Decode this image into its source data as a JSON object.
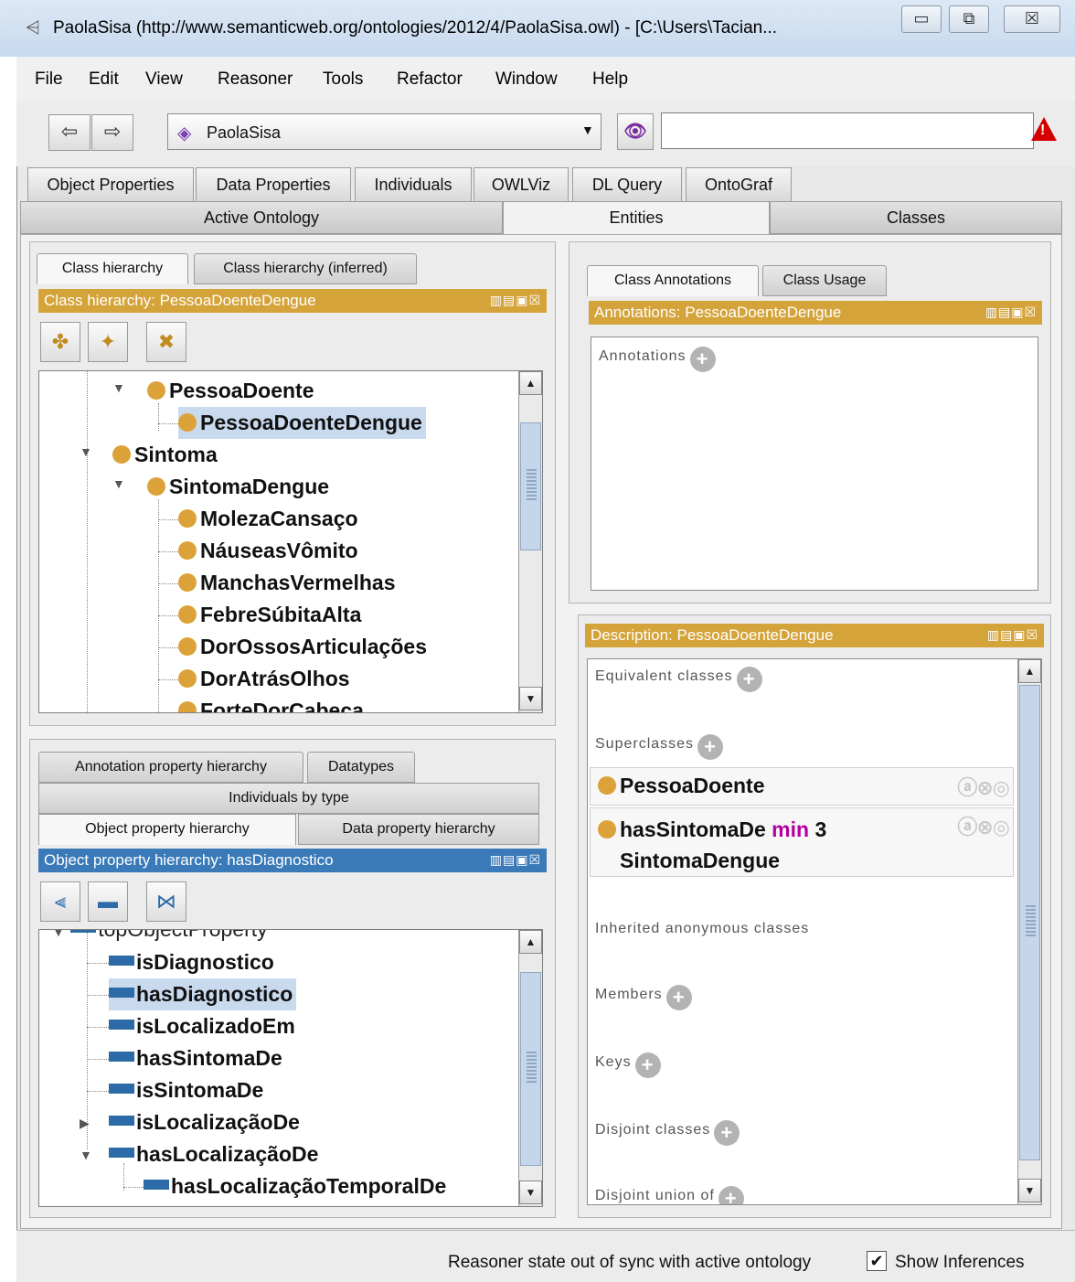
{
  "window": {
    "title": "PaolaSisa (http://www.semanticweb.org/ontologies/2012/4/PaolaSisa.owl) - [C:\\Users\\Tacian...",
    "minimize": "▭",
    "maximize": "⧉",
    "close": "☒"
  },
  "menu": [
    "File",
    "Edit",
    "View",
    "Reasoner",
    "Tools",
    "Refactor",
    "Window",
    "Help"
  ],
  "toolbar": {
    "back": "⇦",
    "forward": "⇨",
    "ontology": "PaolaSisa",
    "search_value": "",
    "search_icon": "binoculars-icon",
    "warning_icon": "warning-icon"
  },
  "tabs_row1": [
    "Object Properties",
    "Data Properties",
    "Individuals",
    "OWLViz",
    "DL Query",
    "OntoGraf"
  ],
  "tabs_row2": [
    "Active Ontology",
    "Entities",
    "Classes"
  ],
  "active_tab": "Entities",
  "class_panel": {
    "tabs": [
      "Class hierarchy",
      "Class hierarchy (inferred)"
    ],
    "header": "Class hierarchy: PessoaDoenteDengue",
    "tree": [
      {
        "label": "PessoaDoente",
        "expanded": true
      },
      {
        "label": "PessoaDoenteDengue",
        "selected": true
      },
      {
        "label": "Sintoma",
        "expanded": true
      },
      {
        "label": "SintomaDengue",
        "expanded": true
      },
      {
        "label": "MolezaCansaço"
      },
      {
        "label": "NáuseasVômito"
      },
      {
        "label": "ManchasVermelhas"
      },
      {
        "label": "FebreSúbitaAlta"
      },
      {
        "label": "DorOssosArticulações"
      },
      {
        "label": "DorAtrásOlhos"
      },
      {
        "label": "ForteDorCabeça"
      }
    ]
  },
  "property_panel": {
    "tabs_top": [
      "Annotation property hierarchy",
      "Datatypes"
    ],
    "tab_mid": "Individuals by type",
    "tabs_bottom": [
      "Object property hierarchy",
      "Data property hierarchy"
    ],
    "header": "Object property hierarchy: hasDiagnostico",
    "tree": [
      {
        "label": "topObjectProperty"
      },
      {
        "label": "isDiagnostico"
      },
      {
        "label": "hasDiagnostico",
        "selected": true
      },
      {
        "label": "isLocalizadoEm"
      },
      {
        "label": "hasSintomaDe"
      },
      {
        "label": "isSintomaDe"
      },
      {
        "label": "isLocalizaçãoDe",
        "collapsed": true
      },
      {
        "label": "hasLocalizaçãoDe",
        "expanded": true
      },
      {
        "label": "hasLocalizaçãoTemporalDe"
      }
    ]
  },
  "annotations_panel": {
    "tabs": [
      "Class Annotations",
      "Class Usage"
    ],
    "header": "Annotations: PessoaDoenteDengue",
    "label": "Annotations"
  },
  "description_panel": {
    "header": "Description: PessoaDoenteDengue",
    "sections": {
      "equivalent": "Equivalent classes",
      "superclasses": "Superclasses",
      "inherited": "Inherited anonymous classes",
      "members": "Members",
      "keys": "Keys",
      "disjoint": "Disjoint classes",
      "disjoint_union": "Disjoint union of"
    },
    "superclass_items": [
      {
        "label": "PessoaDoente"
      },
      {
        "prop": "hasSintomaDe",
        "keyword": "min",
        "number": "3",
        "filler": "SintomaDengue"
      }
    ]
  },
  "status": {
    "message": "Reasoner state out of sync with active ontology",
    "checkbox_checked": true,
    "checkbox_label": "Show Inferences"
  },
  "colors": {
    "class_dot": "#dca23a",
    "gold_header": "#d4a33a",
    "blue_header": "#3a7ab8",
    "property_bar": "#2d6aa8",
    "keyword": "#b3009f",
    "warning": "#d40000"
  }
}
